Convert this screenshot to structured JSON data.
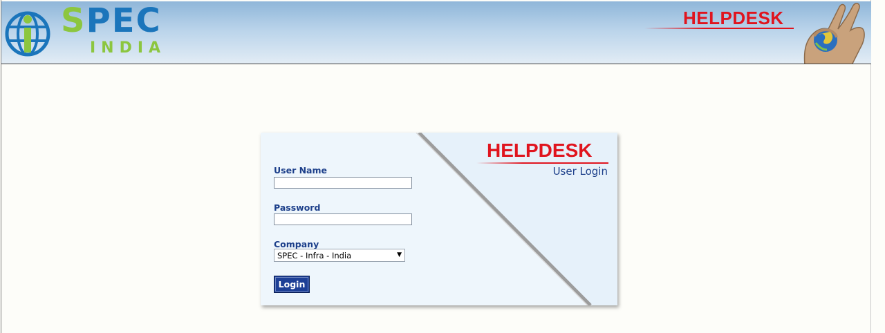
{
  "header": {
    "logo_spec_first": "S",
    "logo_spec_rest": "PEC",
    "logo_india": "INDIA",
    "title": "HELPDESK"
  },
  "login": {
    "title": "HELPDESK",
    "subtitle": "User Login",
    "username_label": "User Name",
    "username_value": "",
    "password_label": "Password",
    "password_value": "",
    "company_label": "Company",
    "company_selected": "SPEC - Infra - India",
    "login_button": "Login"
  },
  "colors": {
    "brand_red": "#e0141e",
    "brand_blue": "#1b75bb",
    "brand_green": "#8cc63f",
    "label_blue": "#1c3f8a",
    "button_blue": "#1d3f96"
  },
  "icons": {
    "logo": "spec-globe-logo-icon",
    "hand": "hand-globe-icon",
    "dropdown": "chevron-down-icon"
  }
}
